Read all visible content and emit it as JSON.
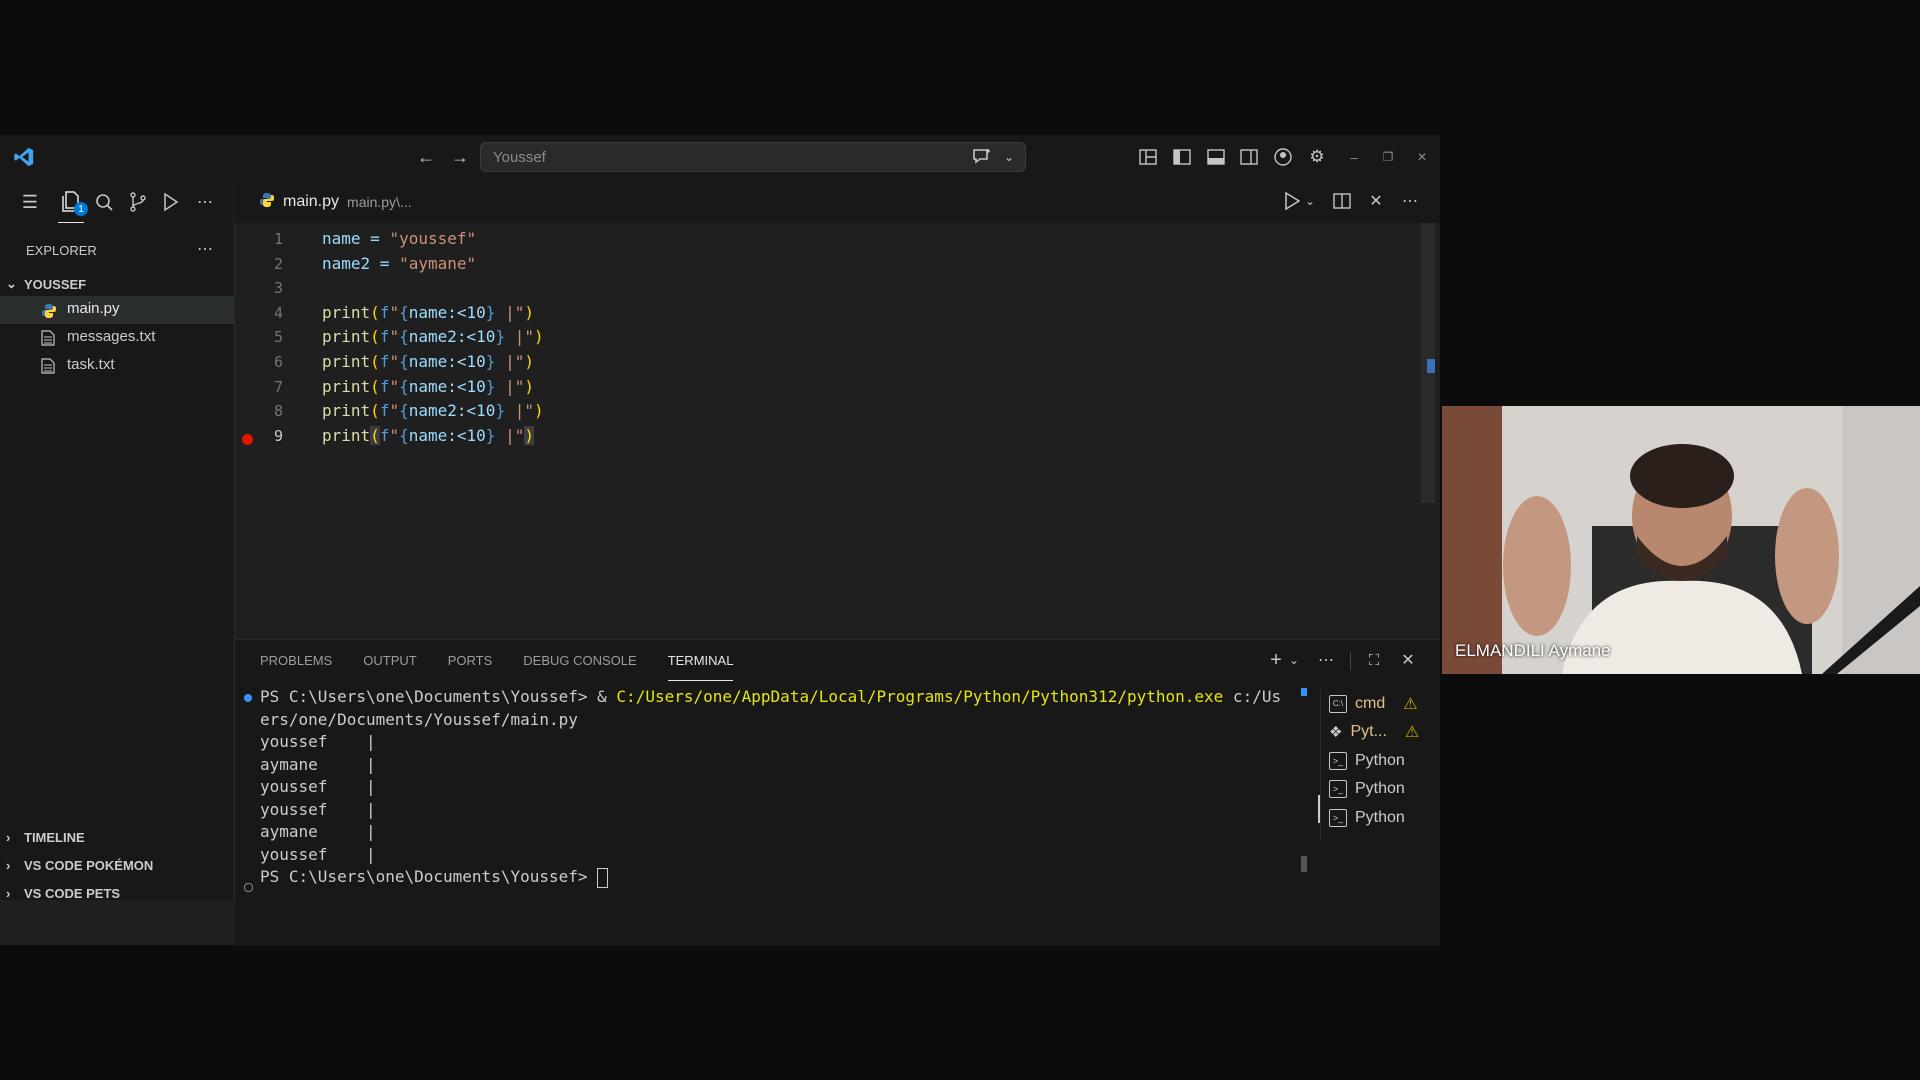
{
  "titlebar": {
    "search_text": "Youssef"
  },
  "sidebar": {
    "explorer_label": "EXPLORER",
    "explorer_badge": "1",
    "folder_name": "YOUSSEF",
    "files": [
      {
        "name": "main.py",
        "icon": "python-file-icon"
      },
      {
        "name": "messages.txt",
        "icon": "text-file-icon"
      },
      {
        "name": "task.txt",
        "icon": "text-file-icon"
      }
    ],
    "sections": [
      "TIMELINE",
      "VS CODE POKÉMON",
      "VS CODE PETS"
    ]
  },
  "editor": {
    "tab_name": "main.py",
    "tab_path": "main.py\\...",
    "line_numbers": [
      "1",
      "2",
      "3",
      "4",
      "5",
      "6",
      "7",
      "8",
      "9"
    ],
    "lines": [
      {
        "var": "name",
        "val": "\"youssef\""
      },
      {
        "var": "name2",
        "val": "\"aymane\""
      },
      {
        "empty": true
      },
      {
        "fn": "print",
        "arg": "name"
      },
      {
        "fn": "print",
        "arg": "name2"
      },
      {
        "fn": "print",
        "arg": "name"
      },
      {
        "fn": "print",
        "arg": "name"
      },
      {
        "fn": "print",
        "arg": "name2"
      },
      {
        "fn": "print",
        "arg": "name"
      }
    ],
    "line1": "name = ",
    "line1_str": "\"youssef\"",
    "line2": "name2 = ",
    "line2_str": "\"aymane\"",
    "print_fn": "print",
    "fmt_name": "name:<10",
    "fmt_name2": "name2:<10"
  },
  "panel": {
    "tabs": [
      "PROBLEMS",
      "OUTPUT",
      "PORTS",
      "DEBUG CONSOLE",
      "TERMINAL"
    ],
    "active_tab": "TERMINAL",
    "prompt": "PS C:\\Users\\one\\Documents\\Youssef>",
    "command_amp": " & ",
    "command_path": "C:/Users/one/AppData/Local/Programs/Python/Python312/python.exe",
    "command_arg_1": " c:/Us",
    "command_arg_2": "ers/one/Documents/Youssef/main.py",
    "output": [
      "youssef    |",
      "aymane     |",
      "youssef    |",
      "youssef    |",
      "aymane     |",
      "youssef    |"
    ],
    "final_prompt": "PS C:\\Users\\one\\Documents\\Youssef>",
    "terminals": [
      {
        "label": "cmd",
        "warn": true,
        "color": "#e2c08d"
      },
      {
        "label": "Pyt...",
        "warn": true,
        "color": "#e2c08d"
      },
      {
        "label": "Python",
        "warn": false,
        "color": "#cccccc"
      },
      {
        "label": "Python",
        "warn": false,
        "color": "#cccccc"
      },
      {
        "label": "Python",
        "warn": false,
        "color": "#cccccc"
      }
    ]
  },
  "webcam": {
    "participant_name": "ELMANDILI Aymane"
  },
  "colors": {
    "accent": "#0078d4",
    "breakpoint": "#e51400",
    "warning": "#cca700"
  }
}
